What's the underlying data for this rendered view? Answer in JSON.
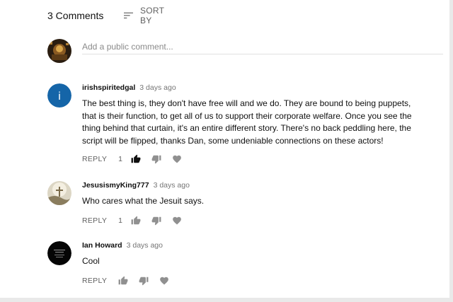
{
  "header": {
    "comment_count": "3 Comments",
    "sort_label": "SORT BY",
    "sort_icon": "sort-lines-icon"
  },
  "compose": {
    "placeholder": "Add a public comment..."
  },
  "comments": [
    {
      "author": "irishspiritedgal",
      "time": "3 days ago",
      "avatar_letter": "i",
      "avatar_color": "#1565a8",
      "text": "The best thing is, they don't have free will and we do. They are bound to being puppets, that is their function, to get all of us to support their corporate welfare. Once you see the thing behind that curtain, it's an entire different story. There's no back peddling here, the script will be flipped, thanks Dan, some undeniable connections on these actors!",
      "reply_label": "REPLY",
      "likes": "1",
      "liked": true
    },
    {
      "author": "JesusismyKing777",
      "time": "3 days ago",
      "text": "Who cares what the Jesuit says.",
      "reply_label": "REPLY",
      "likes": "1",
      "liked": false
    },
    {
      "author": "Ian Howard",
      "time": "3 days ago",
      "text": "Cool",
      "reply_label": "REPLY",
      "likes": "",
      "liked": false
    }
  ],
  "colors": {
    "icon_gray": "#909090",
    "icon_active": "#0f0f0f",
    "time_gray": "#757575"
  }
}
